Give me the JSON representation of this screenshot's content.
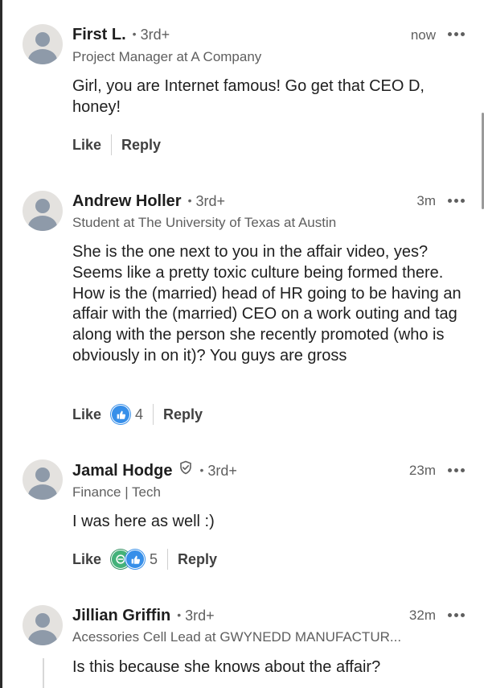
{
  "colors": {
    "like_blue": "#378fe9",
    "celebrate_green": "#44b27a",
    "secondary_text": "#5f5f5f",
    "primary_text": "#1f1f1f"
  },
  "labels": {
    "like": "Like",
    "reply": "Reply"
  },
  "comments": [
    {
      "name": "First L.",
      "degree": "3rd+",
      "headline": "Project Manager at A Company",
      "time": "now",
      "text": "Girl, you are Internet famous! Go get that CEO D, honey!",
      "reaction_icons": [],
      "reaction_count": ""
    },
    {
      "name": "Andrew Holler",
      "degree": "3rd+",
      "headline": "Student at The University of Texas at Austin",
      "time": "3m",
      "text": "She is the one next to you in the affair video, yes? Seems like a pretty toxic culture being formed there. How is the (married) head of HR going to be having an affair with the (married) CEO on a work outing and tag along with the person she recently promoted (who is obviously in on it)? You guys are gross",
      "reaction_icons": [
        "like-icon"
      ],
      "reaction_count": "4"
    },
    {
      "name": "Jamal Hodge",
      "degree": "3rd+",
      "verified": true,
      "headline": "Finance | Tech",
      "time": "23m",
      "text": "I was here as well :)",
      "reaction_icons": [
        "celebrate-icon",
        "like-icon"
      ],
      "reaction_count": "5"
    },
    {
      "name": "Jillian Griffin",
      "degree": "3rd+",
      "headline": "Acessories Cell Lead at GWYNEDD MANUFACTUR...",
      "time": "32m",
      "text": "Is this because she knows about the affair?"
    }
  ]
}
